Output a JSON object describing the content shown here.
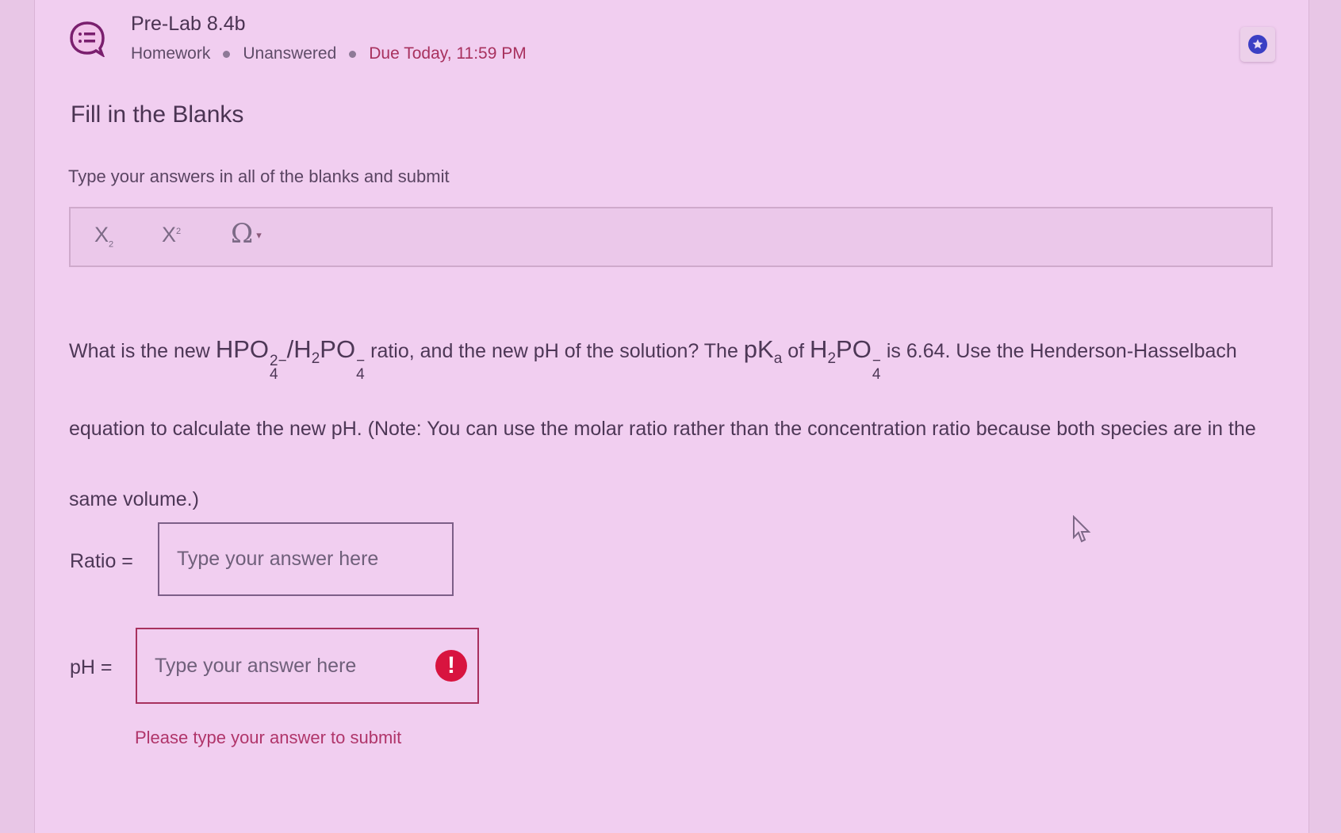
{
  "assignment": {
    "icon": "chat-list-icon",
    "title": "Pre-Lab 8.4b",
    "type": "Homework",
    "status": "Unanswered",
    "due": "Due Today, 11:59 PM",
    "bookmark_icon": "star-icon"
  },
  "question_type": "Fill in the Blanks",
  "instructions": "Type your answers in all of the blanks and submit",
  "toolbar": {
    "subscript_label": "X",
    "subscript_mark": "2",
    "superscript_label": "X",
    "superscript_mark": "2",
    "special_chars_label": "Ω",
    "special_chars_caret": "▾"
  },
  "question": {
    "p1": "What is the new ",
    "hpo4": "HPO",
    "hpo4_sub": "4",
    "hpo4_sup": "2−",
    "slash": "/",
    "h2po4_h": "H",
    "h2po4_sub2": "2",
    "h2po4_po": "PO",
    "h2po4_sub": "4",
    "h2po4_sup": "−",
    "p2": " ratio, and the new pH of the solution? The ",
    "pka": "pK",
    "pka_sub": "a",
    "p3": " of ",
    "p4": " is 6.64. Use the Henderson-Hasselbach equation to calculate the new pH. (Note: You can use the molar ratio rather than the concentration ratio because both species are in the same volume.)"
  },
  "answers": {
    "ratio_label": "Ratio =",
    "ratio_placeholder": "Type your answer here",
    "ratio_value": "",
    "ph_label": "pH =",
    "ph_placeholder": "Type your answer here",
    "ph_value": "",
    "error_icon": "exclamation-icon",
    "error_mark": "!",
    "error_message": "Please type your answer to submit"
  },
  "colors": {
    "background": "#f1cef0",
    "accent_due": "#a8315e",
    "error": "#d8143f",
    "star_button": "#3b3fc4"
  }
}
